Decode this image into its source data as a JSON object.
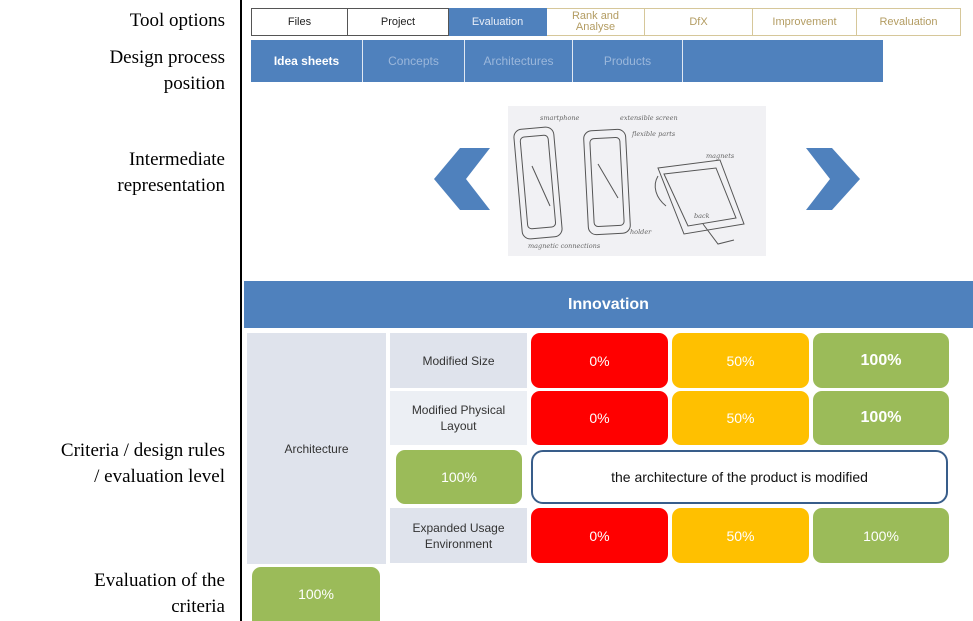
{
  "annotations": {
    "tool_options": "Tool options",
    "design_process_1": "Design process",
    "design_process_2": "position",
    "intermediate_1": "Intermediate",
    "intermediate_2": "representation",
    "criteria_1": "Criteria / design rules",
    "criteria_2": "/ evaluation level",
    "evaluation_1": "Evaluation of the",
    "evaluation_2": "criteria"
  },
  "tabs": {
    "files": "Files",
    "project": "Project",
    "evaluation": "Evaluation",
    "rank_1": "Rank and",
    "rank_2": "Analyse",
    "dfx": "DfX",
    "improvement": "Improvement",
    "revaluation": "Revaluation",
    "active": "Evaluation"
  },
  "subtabs": {
    "idea_sheets": "Idea sheets",
    "concepts": "Concepts",
    "architectures": "Architectures",
    "products": "Products",
    "active": "Idea sheets"
  },
  "sketch": {
    "label_smartphone": "smartphone",
    "label_extensible": "extensible screen",
    "label_flexible": "flexible parts",
    "label_magnets": "magnets",
    "label_back": "back",
    "label_connections": "magnetic connections",
    "label_holder": "holder"
  },
  "section": {
    "title": "Innovation"
  },
  "criteria": {
    "group_label": "Architecture",
    "group_score": "100%",
    "rows": [
      {
        "label": "Modified Size",
        "opt0": "0%",
        "opt50": "50%",
        "opt100": "100%"
      },
      {
        "label_1": "Modified Physical",
        "label_2": "Layout",
        "opt0": "0%",
        "opt50": "50%",
        "opt100": "100%"
      },
      {
        "score": "100%",
        "description": "the architecture of the product is modified"
      },
      {
        "label_1": "Expanded Usage",
        "label_2": "Environment",
        "opt0": "0%",
        "opt50": "50%",
        "opt100": "100%"
      }
    ]
  },
  "colors": {
    "accent_blue": "#4f81bd",
    "red": "#ff0000",
    "amber": "#ffc000",
    "green": "#9bbb59"
  }
}
